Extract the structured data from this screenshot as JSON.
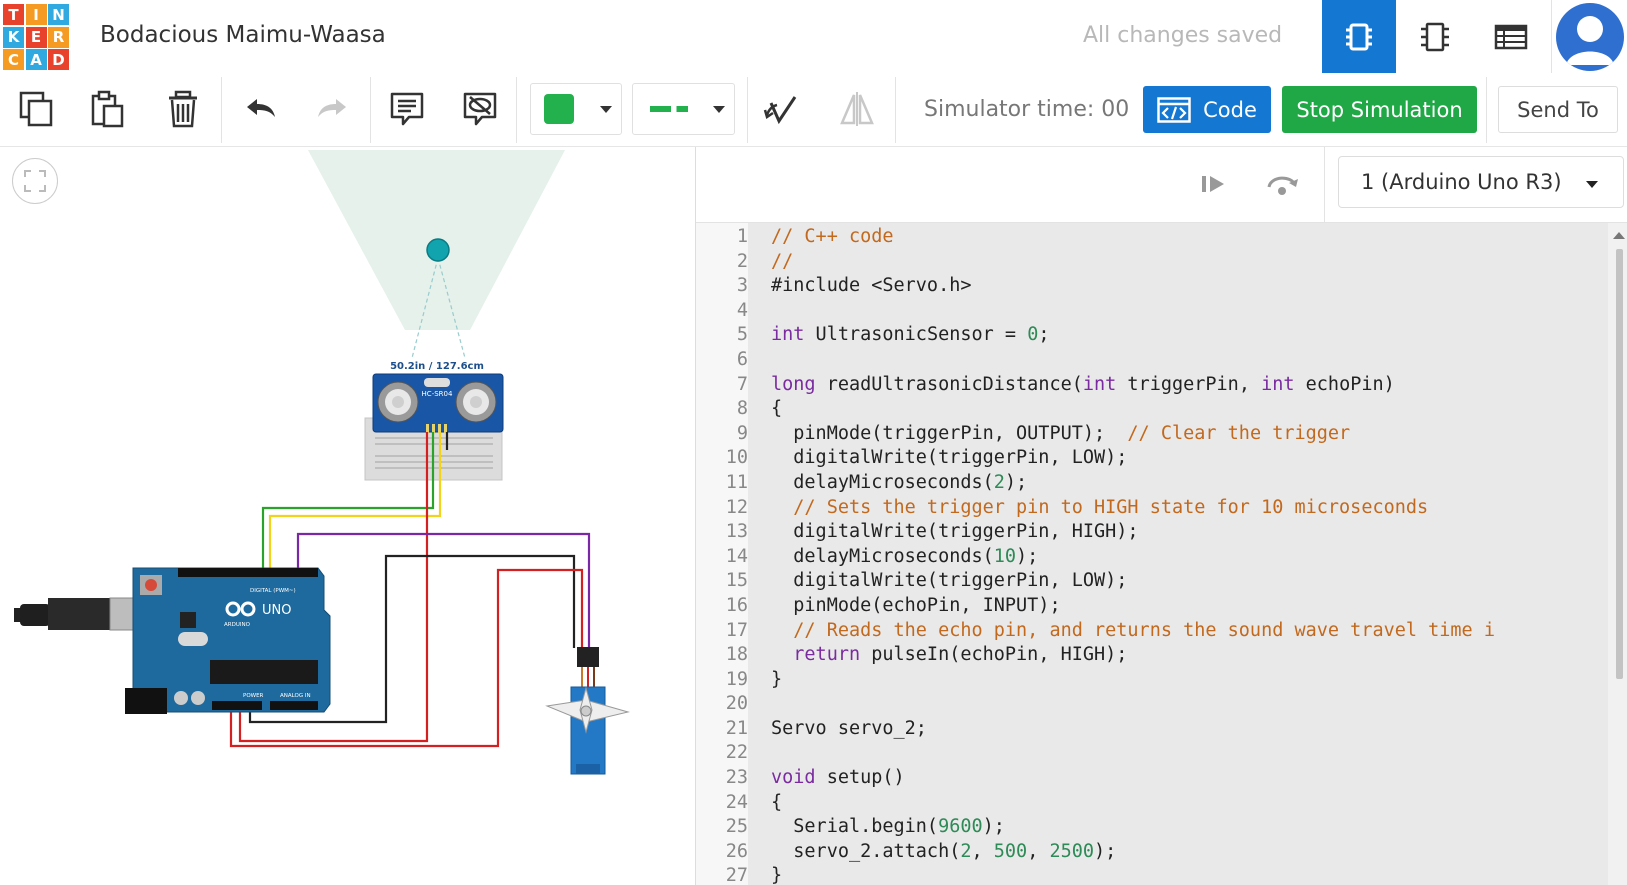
{
  "app": {
    "logo_letters": [
      "T",
      "I",
      "N",
      "K",
      "E",
      "R",
      "C",
      "A",
      "D"
    ],
    "logo_colors": [
      "#e8412c",
      "#f59a22",
      "#2fa9df",
      "#2fa9df",
      "#e8412c",
      "#f59a22",
      "#f59a22",
      "#2fa9df",
      "#e8412c"
    ],
    "project_title": "Bodacious Maimu-Waasa",
    "save_status": "All changes saved",
    "accent": "#1477d2"
  },
  "toolbar": {
    "simulator_time": "Simulator time: 00",
    "code_label": "Code",
    "stop_label": "Stop Simulation",
    "send_label": "Send To",
    "fill_color": "#22b14c",
    "line_color": "#22b14c",
    "code_button_color": "#1477d2",
    "stop_button_color": "#21a846"
  },
  "canvas": {
    "distance_label": "50.2in / 127.6cm",
    "sensor_label": "HC-SR04",
    "arduino_label": "UNO",
    "arduino_brand": "ARDUINO",
    "digital_label": "DIGITAL (PWM~)",
    "power_label": "POWER",
    "analog_label": "ANALOG IN"
  },
  "code_panel": {
    "device_select": "1 (Arduino Uno R3)",
    "lines": [
      {
        "n": "1",
        "t": "// C++ code"
      },
      {
        "n": "2",
        "t": "//"
      },
      {
        "n": "3",
        "t": "#include <Servo.h>"
      },
      {
        "n": "4",
        "t": ""
      },
      {
        "n": "5",
        "t": "int UltrasonicSensor = 0;"
      },
      {
        "n": "6",
        "t": ""
      },
      {
        "n": "7",
        "t": "long readUltrasonicDistance(int triggerPin, int echoPin)"
      },
      {
        "n": "8",
        "t": "{"
      },
      {
        "n": "9",
        "t": "  pinMode(triggerPin, OUTPUT);  // Clear the trigger"
      },
      {
        "n": "10",
        "t": "  digitalWrite(triggerPin, LOW);"
      },
      {
        "n": "11",
        "t": "  delayMicroseconds(2);"
      },
      {
        "n": "12",
        "t": "  // Sets the trigger pin to HIGH state for 10 microseconds"
      },
      {
        "n": "13",
        "t": "  digitalWrite(triggerPin, HIGH);"
      },
      {
        "n": "14",
        "t": "  delayMicroseconds(10);"
      },
      {
        "n": "15",
        "t": "  digitalWrite(triggerPin, LOW);"
      },
      {
        "n": "16",
        "t": "  pinMode(echoPin, INPUT);"
      },
      {
        "n": "17",
        "t": "  // Reads the echo pin, and returns the sound wave travel time i"
      },
      {
        "n": "18",
        "t": "  return pulseIn(echoPin, HIGH);"
      },
      {
        "n": "19",
        "t": "}"
      },
      {
        "n": "20",
        "t": ""
      },
      {
        "n": "21",
        "t": "Servo servo_2;"
      },
      {
        "n": "22",
        "t": ""
      },
      {
        "n": "23",
        "t": "void setup()"
      },
      {
        "n": "24",
        "t": "{"
      },
      {
        "n": "25",
        "t": "  Serial.begin(9600);"
      },
      {
        "n": "26",
        "t": "  servo_2.attach(2, 500, 2500);"
      },
      {
        "n": "27",
        "t": "}"
      }
    ],
    "syntax_colors": {
      "comment": "#c2691e",
      "keyword": "#7a2ba0",
      "number": "#2e8b57"
    }
  }
}
